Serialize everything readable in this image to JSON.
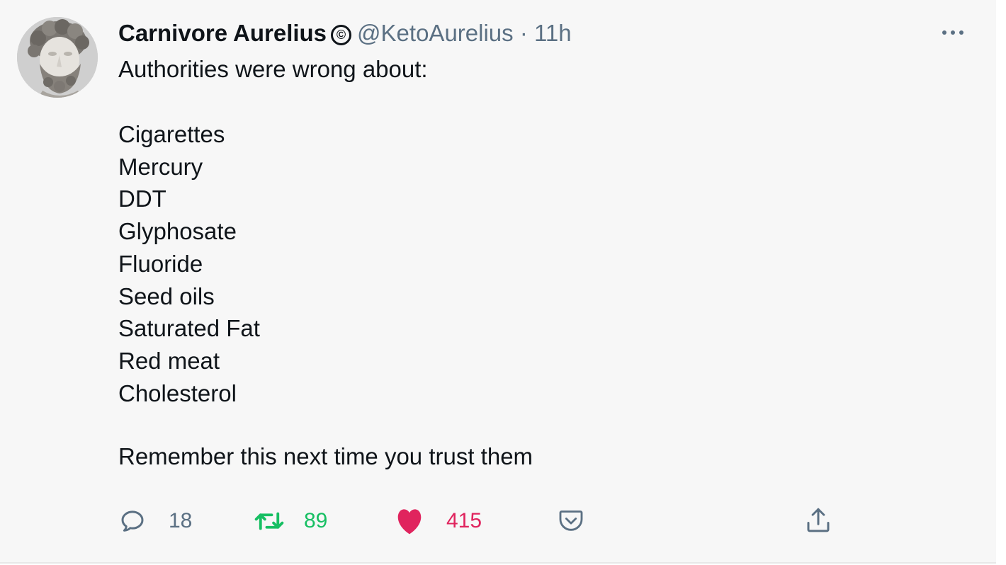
{
  "tweet": {
    "display_name": "Carnivore Aurelius",
    "badge": "©",
    "handle": "@KetoAurelius",
    "separator": "·",
    "time": "11h",
    "intro": "Authorities were wrong about:",
    "list": [
      "Cigarettes",
      "Mercury",
      "DDT",
      "Glyphosate",
      "Fluoride",
      "Seed oils",
      "Saturated Fat",
      "Red meat",
      "Cholesterol"
    ],
    "closing": "Remember this next time you trust them"
  },
  "actions": {
    "reply_count": "18",
    "retweet_count": "89",
    "like_count": "415"
  },
  "colors": {
    "retweet": "#17bf63",
    "like": "#e0245e",
    "muted": "#5b7083"
  },
  "icons": [
    "avatar-statue",
    "more-icon",
    "reply-icon",
    "retweet-icon",
    "heart-icon",
    "pocket-icon",
    "share-icon"
  ]
}
